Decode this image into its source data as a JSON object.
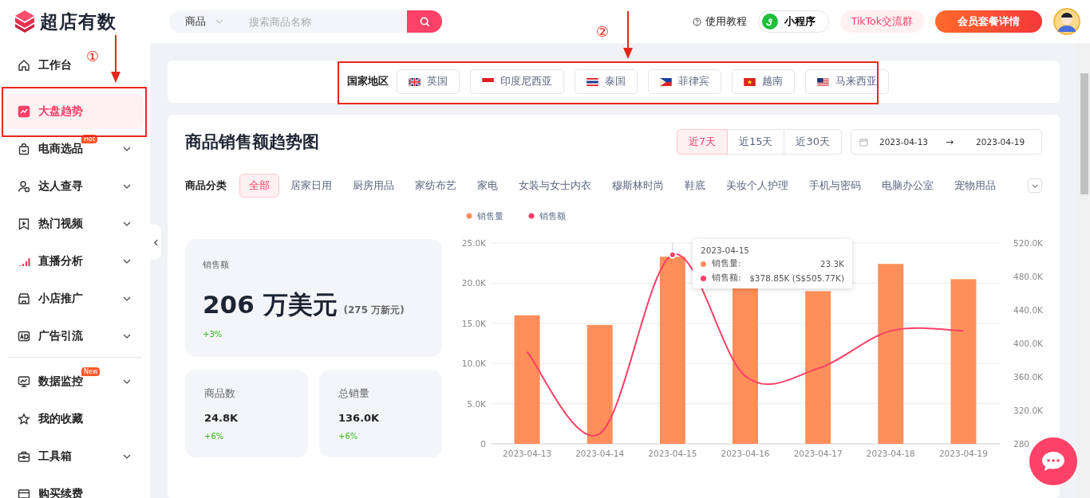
{
  "header": {
    "logo_text": "超店有数",
    "search": {
      "scope": "商品",
      "placeholder": "搜索商品名称"
    },
    "help_link": "使用教程",
    "mini_program": "小程序",
    "tiktok_group": "TikTok交流群",
    "vip_button": "会员套餐详情"
  },
  "sidebar": {
    "items": [
      {
        "label": "工作台",
        "selected": false,
        "expandable": false
      },
      {
        "label": "大盘趋势",
        "selected": true,
        "expandable": false
      },
      {
        "label": "电商选品",
        "selected": false,
        "expandable": true,
        "badge": "Hot"
      },
      {
        "label": "达人查寻",
        "selected": false,
        "expandable": true
      },
      {
        "label": "热门视频",
        "selected": false,
        "expandable": true
      },
      {
        "label": "直播分析",
        "selected": false,
        "expandable": true
      },
      {
        "label": "小店推广",
        "selected": false,
        "expandable": true
      },
      {
        "label": "广告引流",
        "selected": false,
        "expandable": true
      },
      {
        "label": "数据监控",
        "selected": false,
        "expandable": true,
        "badge": "New"
      },
      {
        "label": "我的收藏",
        "selected": false,
        "expandable": false
      },
      {
        "label": "工具箱",
        "selected": false,
        "expandable": true
      },
      {
        "label": "购买续费",
        "selected": false,
        "expandable": false
      }
    ]
  },
  "region": {
    "label": "国家地区",
    "countries": [
      {
        "name": "英国"
      },
      {
        "name": "印度尼西亚"
      },
      {
        "name": "泰国"
      },
      {
        "name": "菲律宾"
      },
      {
        "name": "越南"
      },
      {
        "name": "马来西亚"
      }
    ]
  },
  "trend": {
    "title": "商品销售额趋势图",
    "periods": [
      {
        "label": "近7天",
        "selected": true
      },
      {
        "label": "近15天",
        "selected": false
      },
      {
        "label": "近30天",
        "selected": false
      }
    ],
    "date_range": {
      "start": "2023-04-13",
      "separator": "→",
      "end": "2023-04-19"
    },
    "category_label": "商品分类",
    "categories": [
      {
        "label": "全部",
        "selected": true
      },
      {
        "label": "居家日用",
        "selected": false
      },
      {
        "label": "厨房用品",
        "selected": false
      },
      {
        "label": "家纺布艺",
        "selected": false
      },
      {
        "label": "家电",
        "selected": false
      },
      {
        "label": "女装与女士内衣",
        "selected": false
      },
      {
        "label": "穆斯林时尚",
        "selected": false
      },
      {
        "label": "鞋底",
        "selected": false
      },
      {
        "label": "美妆个人护理",
        "selected": false
      },
      {
        "label": "手机与密码",
        "selected": false
      },
      {
        "label": "电脑办公室",
        "selected": false
      },
      {
        "label": "宠物用品",
        "selected": false
      }
    ],
    "stats": [
      {
        "label": "销售额",
        "value": "206 万美元",
        "sub": "(275 万新元)",
        "change": "+3%"
      },
      {
        "label": "商品数",
        "value": "24.8K",
        "change": "+6%"
      },
      {
        "label": "总销量",
        "value": "136.0K",
        "change": "+6%"
      }
    ],
    "volume_chart": {
      "chart_data": {
        "type": "bar",
        "grid": true,
        "categories": [
          "2023-04-13",
          "2023-04-14",
          "2023-04-15",
          "2023-04-16",
          "2023-04-17",
          "2023-04-18",
          "2023-04-19"
        ],
        "ylim": [
          0,
          25000
        ],
        "yticks": [
          {
            "value": 0,
            "label": "0"
          },
          {
            "value": 5000,
            "label": "5.0K"
          },
          {
            "value": 10000,
            "label": "10.0K"
          },
          {
            "value": 15000,
            "label": "15.0K"
          },
          {
            "value": 20000,
            "label": "20.0K"
          },
          {
            "value": 25000,
            "label": "25.0K"
          }
        ],
        "series": [
          {
            "name": "销售量",
            "color": "#fe8f5a",
            "values": [
              16000,
              14800,
              23300,
              19500,
              19000,
              22400,
              20500
            ]
          }
        ]
      }
    },
    "amount_chart": {
      "chart_data": {
        "type": "line",
        "ylim": [
          280,
          520
        ],
        "yticks": [
          {
            "value": 280,
            "label": "280"
          },
          {
            "value": 320,
            "label": "320.0K"
          },
          {
            "value": 360,
            "label": "360.0K"
          },
          {
            "value": 400,
            "label": "400.0K"
          },
          {
            "value": 440,
            "label": "440.0K"
          },
          {
            "value": 480,
            "label": "480.0K"
          },
          {
            "value": 520,
            "label": "520.0K"
          }
        ],
        "series": [
          {
            "name": "销售额",
            "color": "#fe4167",
            "values": [
              390,
              292,
              506,
              361,
              370,
              415,
              415
            ]
          }
        ]
      }
    },
    "tooltip": {
      "title": "2023-04-15",
      "rows": [
        {
          "label": "销售量:",
          "value": "23.3K",
          "color": "#fe8f5a"
        },
        {
          "label": "销售额:",
          "value": "$378.85K (S$505.77K)",
          "color": "#fe4167"
        }
      ]
    }
  },
  "markup": [
    {
      "number": "①"
    },
    {
      "number": "②"
    }
  ]
}
